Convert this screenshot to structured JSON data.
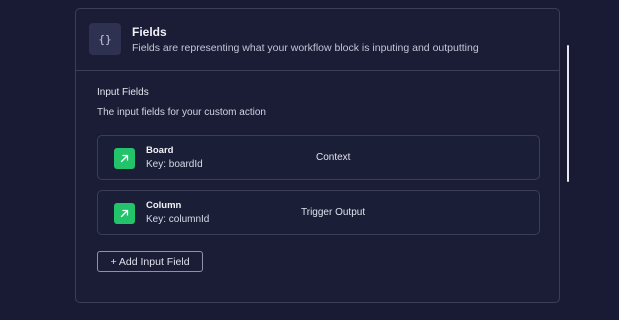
{
  "panel": {
    "icon_glyph": "{}",
    "title": "Fields",
    "subtitle": "Fields are representing what your workflow block is inputing and outputting"
  },
  "input_fields": {
    "title": "Input Fields",
    "description": "The input fields for your custom action",
    "items": [
      {
        "name": "Board",
        "key": "Key: boardId",
        "type": "Context",
        "icon": "arrow-up-right-icon"
      },
      {
        "name": "Column",
        "key": "Key: columnId",
        "type": "Trigger Output",
        "icon": "arrow-up-right-icon"
      }
    ],
    "add_button_label": "+ Add Input Field"
  },
  "colors": {
    "background": "#181b33",
    "border": "#3a3e5a",
    "field_icon": "#22c36b"
  }
}
